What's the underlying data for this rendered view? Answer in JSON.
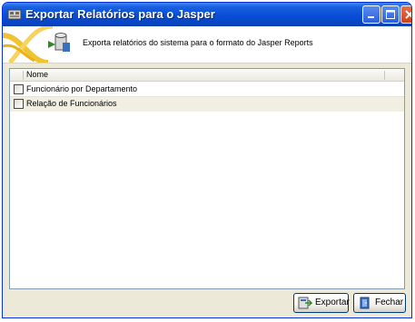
{
  "window": {
    "title": "Exportar Relatórios para o Jasper",
    "app_icon": "app-window-icon"
  },
  "banner": {
    "text": "Exporta relatórios do sistema para o formato do Jasper Reports"
  },
  "list": {
    "columns": [
      "Nome"
    ],
    "rows": [
      {
        "label": "Funcionário por Departamento",
        "checked": false
      },
      {
        "label": "Relação de Funcionários",
        "checked": false
      }
    ]
  },
  "buttons": {
    "export": "Exportar",
    "close": "Fechar"
  }
}
